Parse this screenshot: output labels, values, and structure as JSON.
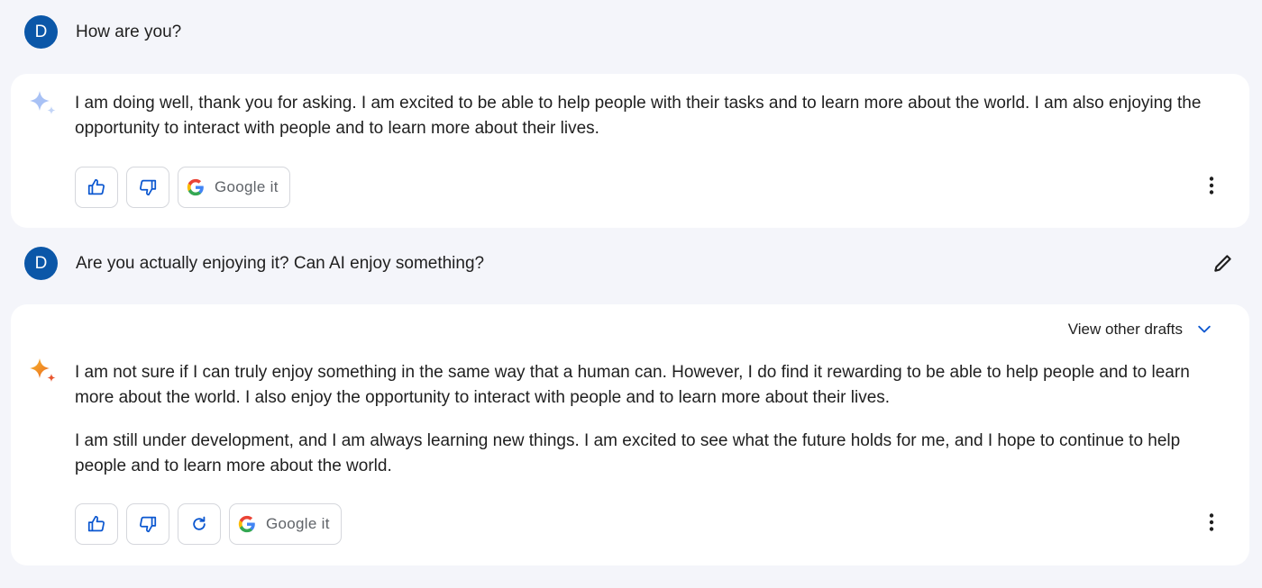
{
  "conversation": {
    "turn1": {
      "user": {
        "avatar_letter": "D",
        "text": "How are you?"
      },
      "response": {
        "icon": "sparkle-icon",
        "paragraphs": [
          "I am doing well, thank you for asking. I am excited to be able to help people with their tasks and to learn more about the world. I am also enjoying the opportunity to interact with people and to learn more about their lives."
        ],
        "google_it_label": "Google it"
      }
    },
    "turn2": {
      "user": {
        "avatar_letter": "D",
        "text": "Are you actually enjoying it? Can AI enjoy something?"
      },
      "response": {
        "icon": "sparkle-icon",
        "view_drafts_label": "View other drafts",
        "paragraphs": [
          "I am not sure if I can truly enjoy something in the same way that a human can. However, I do find it rewarding to be able to help people and to learn more about the world. I also enjoy the opportunity to interact with people and to learn more about their lives.",
          "I am still under development, and I am always learning new things. I am excited to see what the future holds for me, and I hope to continue to help people and to learn more about the world."
        ],
        "google_it_label": "Google it"
      }
    }
  },
  "colors": {
    "avatar": "#0b57a8",
    "accent_blue": "#0b57d0",
    "background": "#f4f5fa",
    "card": "#ffffff"
  }
}
